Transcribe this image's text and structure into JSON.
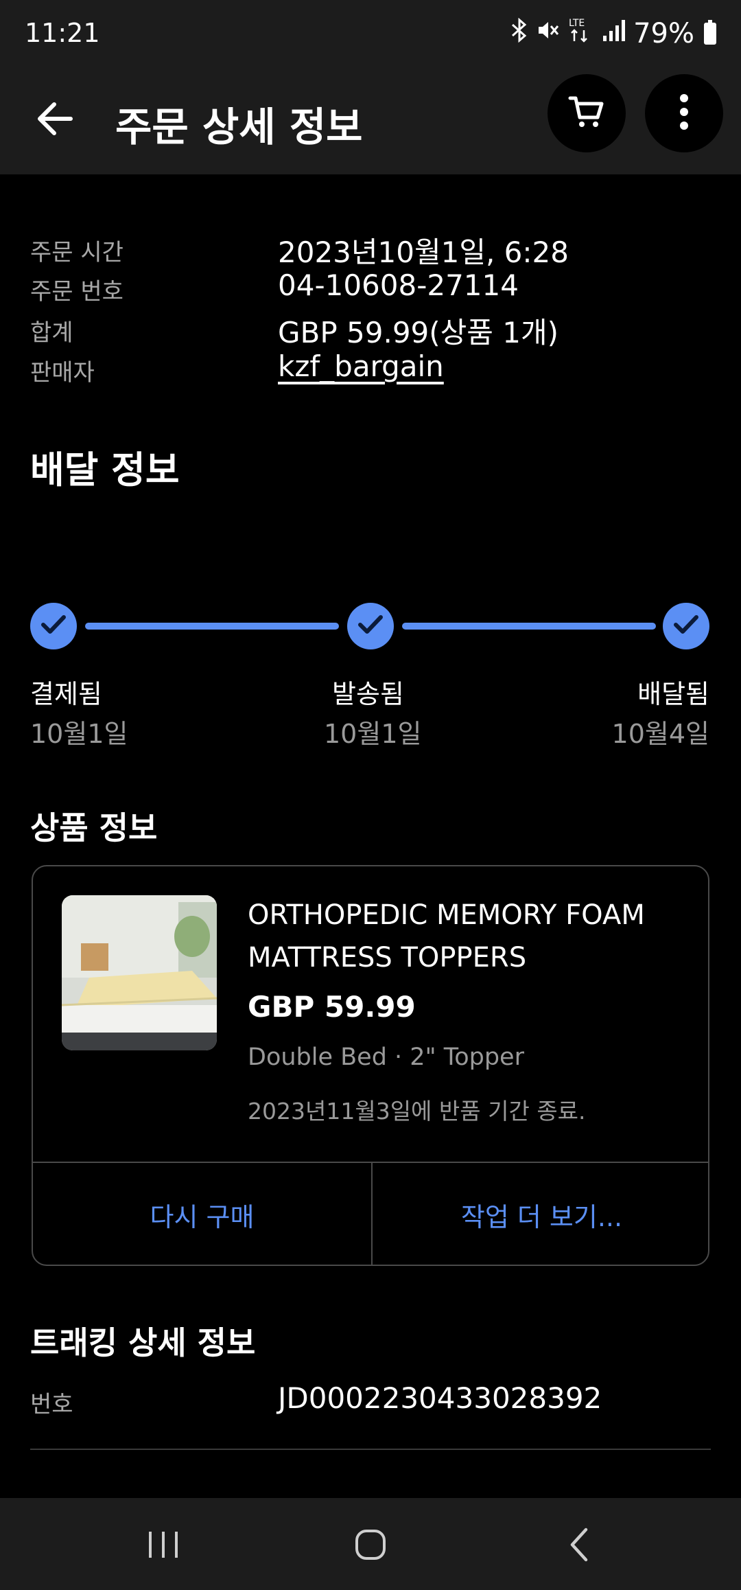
{
  "status_bar": {
    "time": "11:21",
    "battery_percent": "79%",
    "icons": [
      "bluetooth-icon",
      "mute-icon",
      "lte-icon",
      "signal-icon",
      "battery-icon"
    ],
    "network_label": "LTE"
  },
  "app_bar": {
    "title": "주문 상세 정보",
    "icons": [
      "back-arrow-icon",
      "cart-icon",
      "more-vertical-icon"
    ]
  },
  "order": {
    "rows": [
      {
        "label": "주문 시간",
        "value": "2023년10월1일, 6:28"
      },
      {
        "label": "주문 번호",
        "value": "04-10608-27114"
      },
      {
        "label": "합계",
        "value": "GBP 59.99(상품 1개)"
      },
      {
        "label": "판매자",
        "value": "kzf_bargain"
      }
    ]
  },
  "delivery": {
    "title": "배달 정보",
    "steps": [
      {
        "label": "결제됨",
        "date": "10월1일",
        "completed": true
      },
      {
        "label": "발송됨",
        "date": "10월1일",
        "completed": true
      },
      {
        "label": "배달됨",
        "date": "10월4일",
        "completed": true
      }
    ]
  },
  "product": {
    "section_title": "상품 정보",
    "title": "ORTHOPEDIC MEMORY FOAM MATTRESS TOPPERS",
    "price": "GBP 59.99",
    "variant": "Double Bed · 2\" Topper",
    "return_note": "2023년11월3일에 반품 기간 종료.",
    "buy_again_label": "다시 구매",
    "more_actions_label": "작업 더 보기..."
  },
  "tracking": {
    "title": "트래킹 상세 정보",
    "number_label": "번호",
    "number_value": "JD0002230433028392"
  },
  "nav_bar": {
    "icons": [
      "recent-apps-icon",
      "home-icon",
      "back-nav-icon"
    ]
  },
  "colors": {
    "accent": "#5b8ff4",
    "background": "#000000",
    "bar_background": "#1c1c1c",
    "muted_text": "#9a9a9a"
  }
}
